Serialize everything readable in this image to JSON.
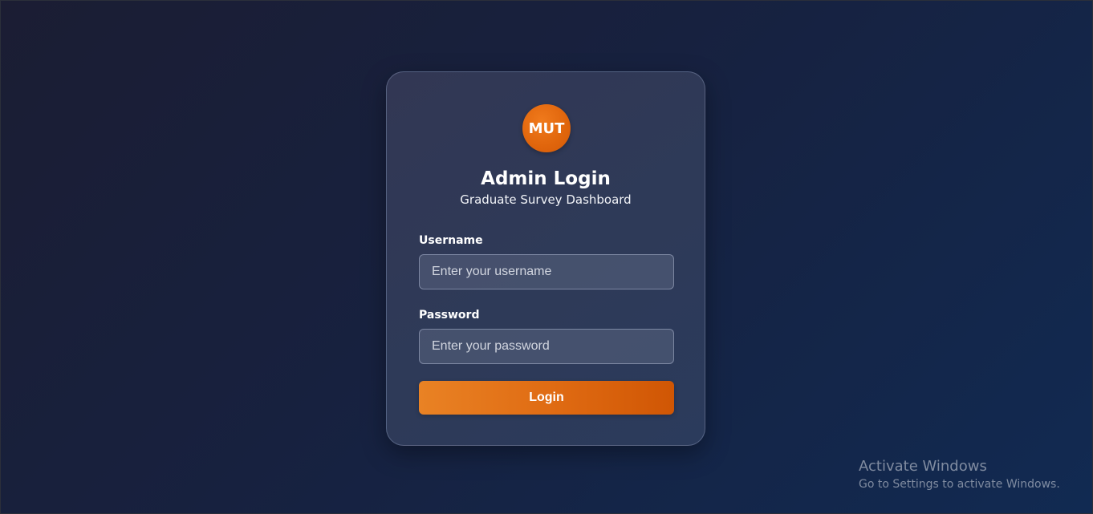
{
  "login": {
    "logo_text": "MUT",
    "title": "Admin Login",
    "subtitle": "Graduate Survey Dashboard",
    "username": {
      "label": "Username",
      "placeholder": "Enter your username",
      "value": ""
    },
    "password": {
      "label": "Password",
      "placeholder": "Enter your password",
      "value": ""
    },
    "submit_label": "Login"
  },
  "watermark": {
    "title": "Activate Windows",
    "subtitle": "Go to Settings to activate Windows."
  },
  "colors": {
    "accent": "#e0650c",
    "background": "#17213f",
    "card": "#2e3a58"
  }
}
